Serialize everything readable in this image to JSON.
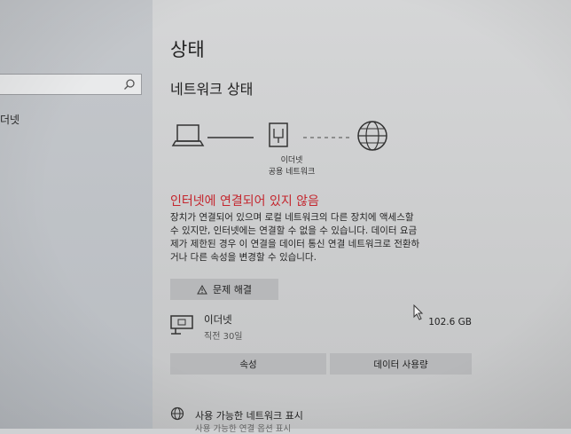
{
  "sidebar": {
    "search": {
      "value": ""
    },
    "items": [
      {
        "label": "더넷"
      }
    ]
  },
  "main": {
    "page_title": "상태",
    "section_title": "네트워크 상태",
    "adapter": {
      "name": "이더넷",
      "type": "공용 네트워크"
    },
    "status_heading": "인터넷에 연결되어 있지 않음",
    "status_description": [
      "장치가 연결되어 있으며 로컬 네트워크의 다른 장치에 액세스할",
      "수 있지만, 인터넷에는 연결할 수 없을 수 있습니다. 데이터 요금",
      "제가 제한된 경우 이 연결을 데이터 통신 연결 네트워크로 전환하",
      "거나 다른 속성을 변경할 수 있습니다."
    ],
    "troubleshoot_label": "문제 해결",
    "connection": {
      "name": "이더넷",
      "time": "직전 30일",
      "size": "102.6 GB"
    },
    "properties_label": "속성",
    "data_usage_label": "데이터 사용량",
    "available_networks_label": "사용 가능한 네트워크 표시",
    "available_networks_sub": "사용 가능한 연결 옵션 표시"
  },
  "colors": {
    "error": "#c4262e",
    "button": "#b7b8ba"
  }
}
